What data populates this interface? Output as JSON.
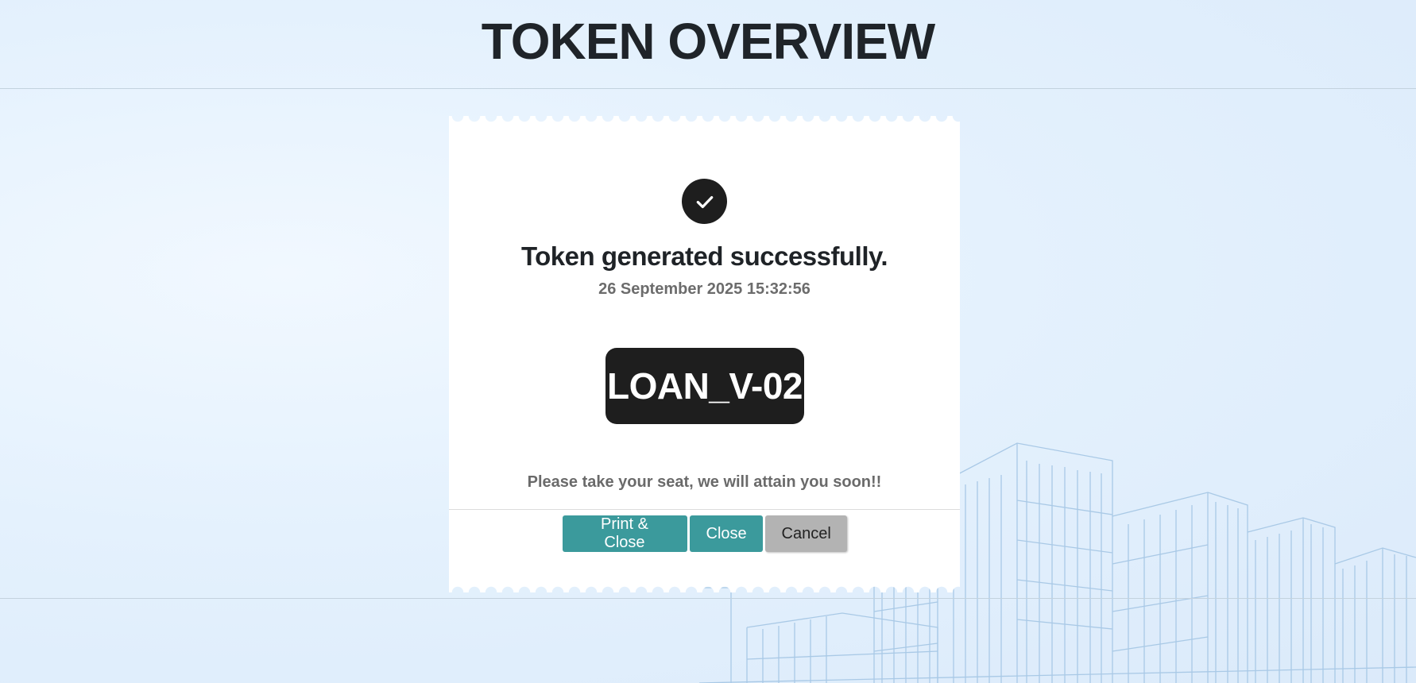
{
  "header": {
    "title": "TOKEN OVERVIEW"
  },
  "ticket": {
    "status_icon": "check-icon",
    "message": "Token generated successfully.",
    "timestamp": "26 September 2025 15:32:56",
    "token": "LOAN_V-02",
    "instruction": "Please take your seat, we will attain you soon!!"
  },
  "actions": {
    "print_close_label": "Print & Close",
    "close_label": "Close",
    "cancel_label": "Cancel"
  },
  "colors": {
    "accent": "#3b9a9c",
    "badge": "#1e1e1e",
    "secondary_button": "#b3b3b3"
  }
}
